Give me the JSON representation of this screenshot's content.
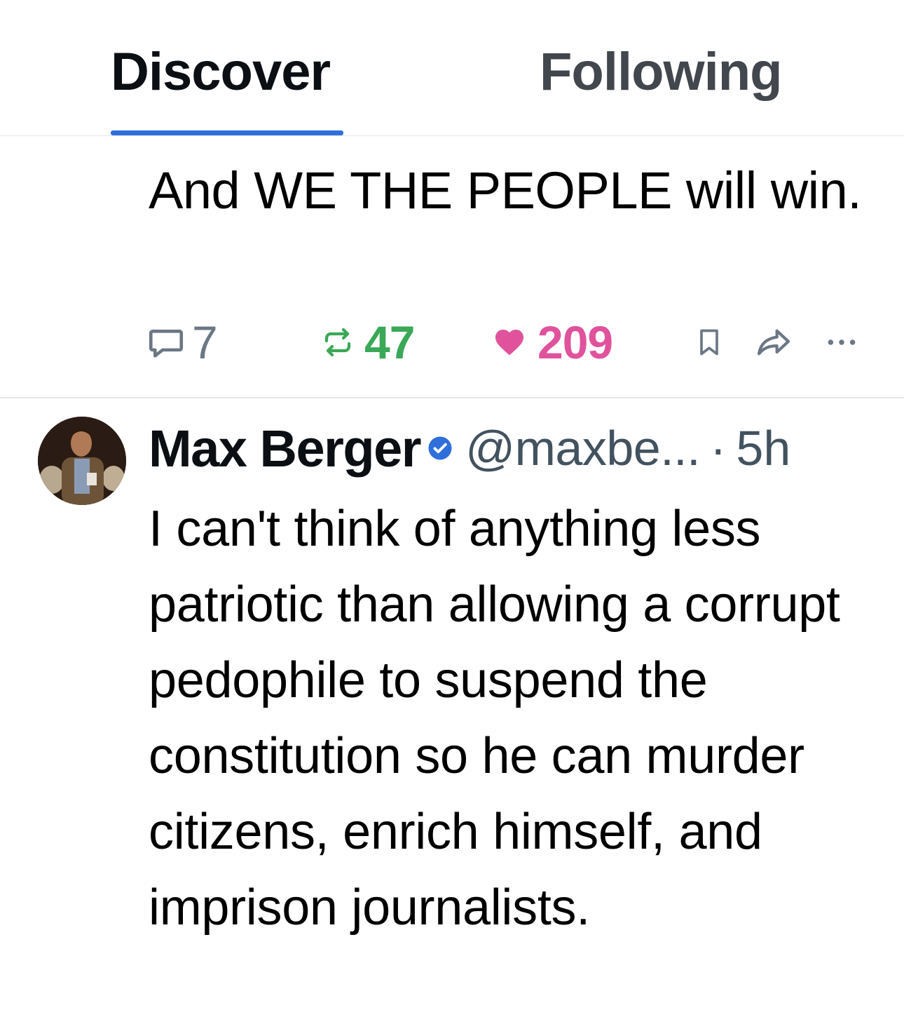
{
  "tabs": [
    {
      "label": "Discover",
      "active": true
    },
    {
      "label": "Following",
      "active": false
    }
  ],
  "colors": {
    "accent": "#2f6fdb",
    "repost": "#3aa856",
    "like": "#e0529c",
    "muted": "#6b7785"
  },
  "post_previous": {
    "text": "And WE THE PEOPLE will win.",
    "actions": {
      "reply_count": "7",
      "repost_count": "47",
      "like_count": "209",
      "icons": [
        "reply-icon",
        "repost-icon",
        "heart-icon",
        "bookmark-icon",
        "share-icon",
        "more-icon"
      ]
    }
  },
  "post": {
    "author_name": "Max Berger",
    "verified": true,
    "handle": "@maxbe...",
    "separator": "·",
    "time": "5h",
    "text": "I can't think of anything less patriotic than allowing a corrupt pedophile to suspend the constitution so he can murder citizens, enrich himself, and imprison journalists."
  }
}
